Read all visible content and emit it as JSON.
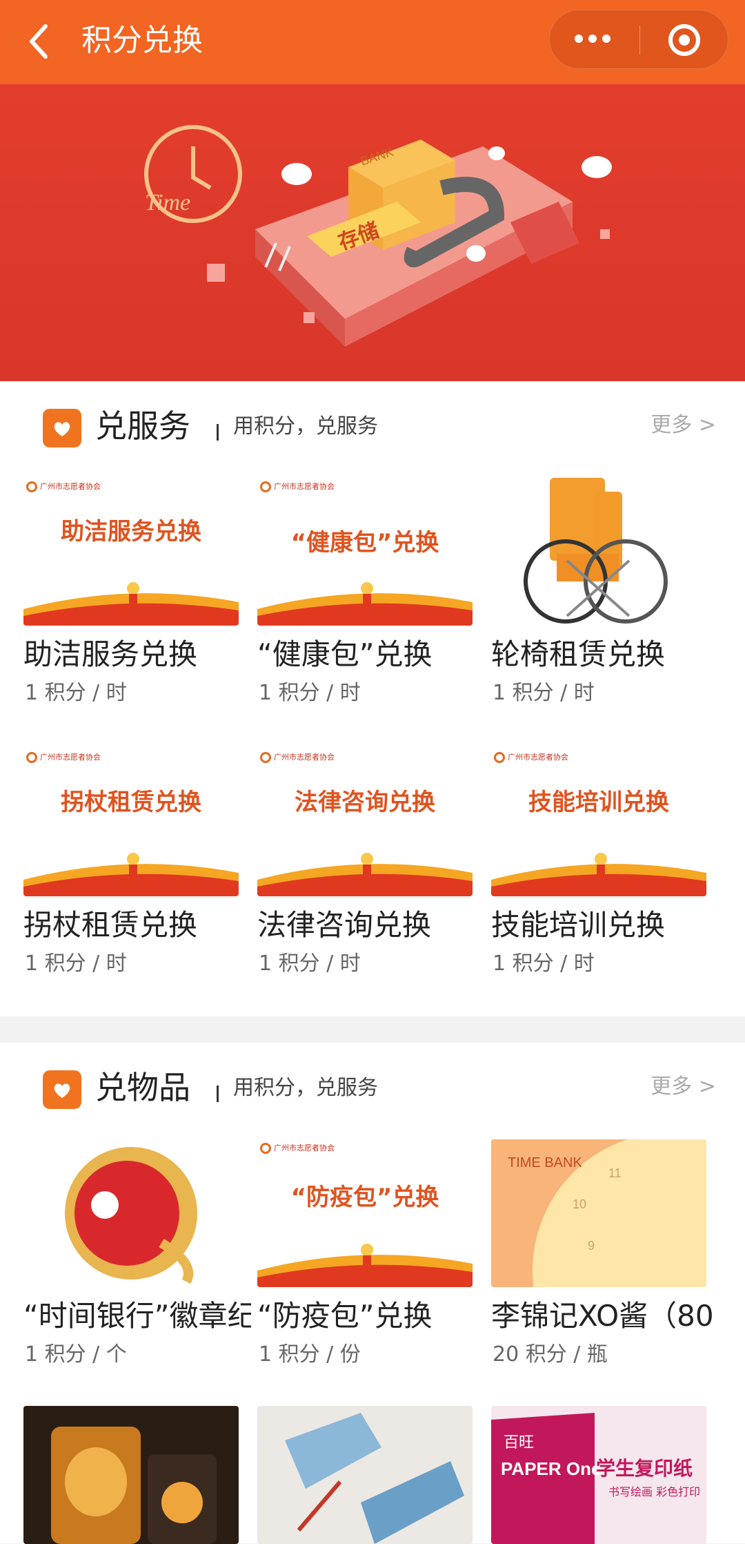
{
  "topbar": {
    "title": "积分兑换"
  },
  "banner": {
    "time_text": "Time",
    "bank_text": "BANK",
    "store_text": "存储"
  },
  "services": {
    "title": "兑服务",
    "subtitle": "用积分，兑服务",
    "more": "更多 >",
    "poster_logo": "广州市志愿者协会",
    "items": [
      {
        "name": "助洁服务兑换",
        "price": "1 积分 / 时",
        "poster": "助洁服务兑换"
      },
      {
        "name": "“健康包”兑换",
        "price": "1 积分 / 时",
        "poster": "“健康包”兑换"
      },
      {
        "name": "轮椅租赁兑换",
        "price": "1 积分 / 时"
      },
      {
        "name": "拐杖租赁兑换",
        "price": "1 积分 / 时",
        "poster": "拐杖租赁兑换"
      },
      {
        "name": "法律咨询兑换",
        "price": "1 积分 / 时",
        "poster": "法律咨询兑换"
      },
      {
        "name": "技能培训兑换",
        "price": "1 积分 / 时",
        "poster": "技能培训兑换"
      }
    ]
  },
  "goods": {
    "title": "兑物品",
    "subtitle": "用积分，兑服务",
    "more": "更多 >",
    "items": [
      {
        "name": "“时间银行”徽章纪",
        "price": "1 积分 / 个"
      },
      {
        "name": "“防疫包”兑换",
        "price": "1 积分 / 份",
        "poster": "“防疫包”兑换"
      },
      {
        "name": "李锦记XO酱（80",
        "price": "20 积分 / 瓶",
        "card_text": "TIME BANK"
      }
    ],
    "row2": {
      "paper_brand": "百旺",
      "paper_name": "PAPER One",
      "paper_title": "学生复印纸",
      "paper_sub": "书写绘画 彩色打印"
    }
  },
  "colors": {
    "accent": "#f26522",
    "banner": "#e03c2d",
    "orange": "#f0741f"
  }
}
